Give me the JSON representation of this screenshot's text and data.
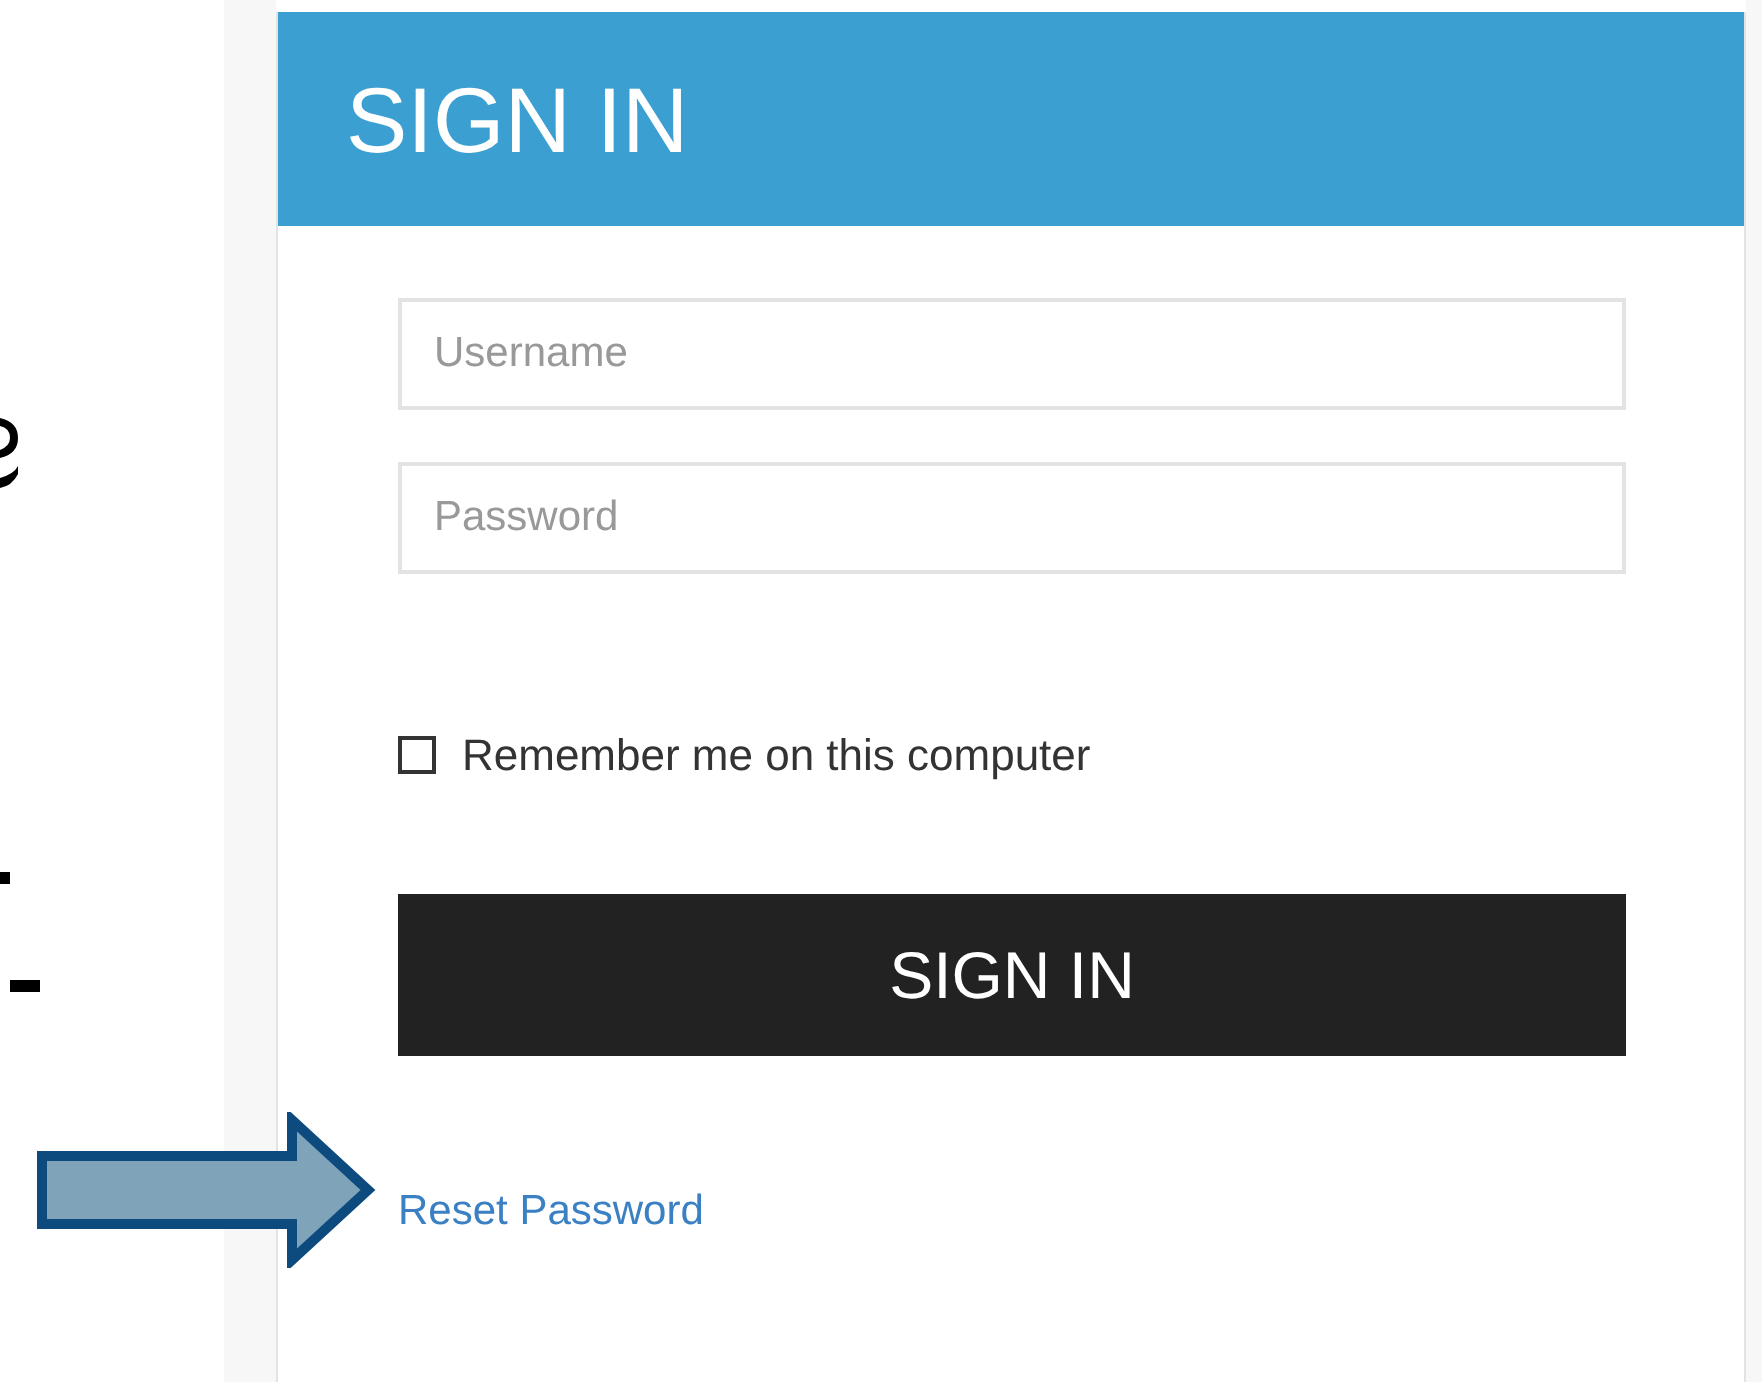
{
  "panel": {
    "title": "SIGN IN"
  },
  "form": {
    "username": {
      "placeholder": "Username"
    },
    "password": {
      "placeholder": "Password"
    },
    "remember": {
      "label": "Remember me on this computer",
      "checked": false
    },
    "submit": "SIGN IN",
    "reset_link": "Reset Password"
  }
}
